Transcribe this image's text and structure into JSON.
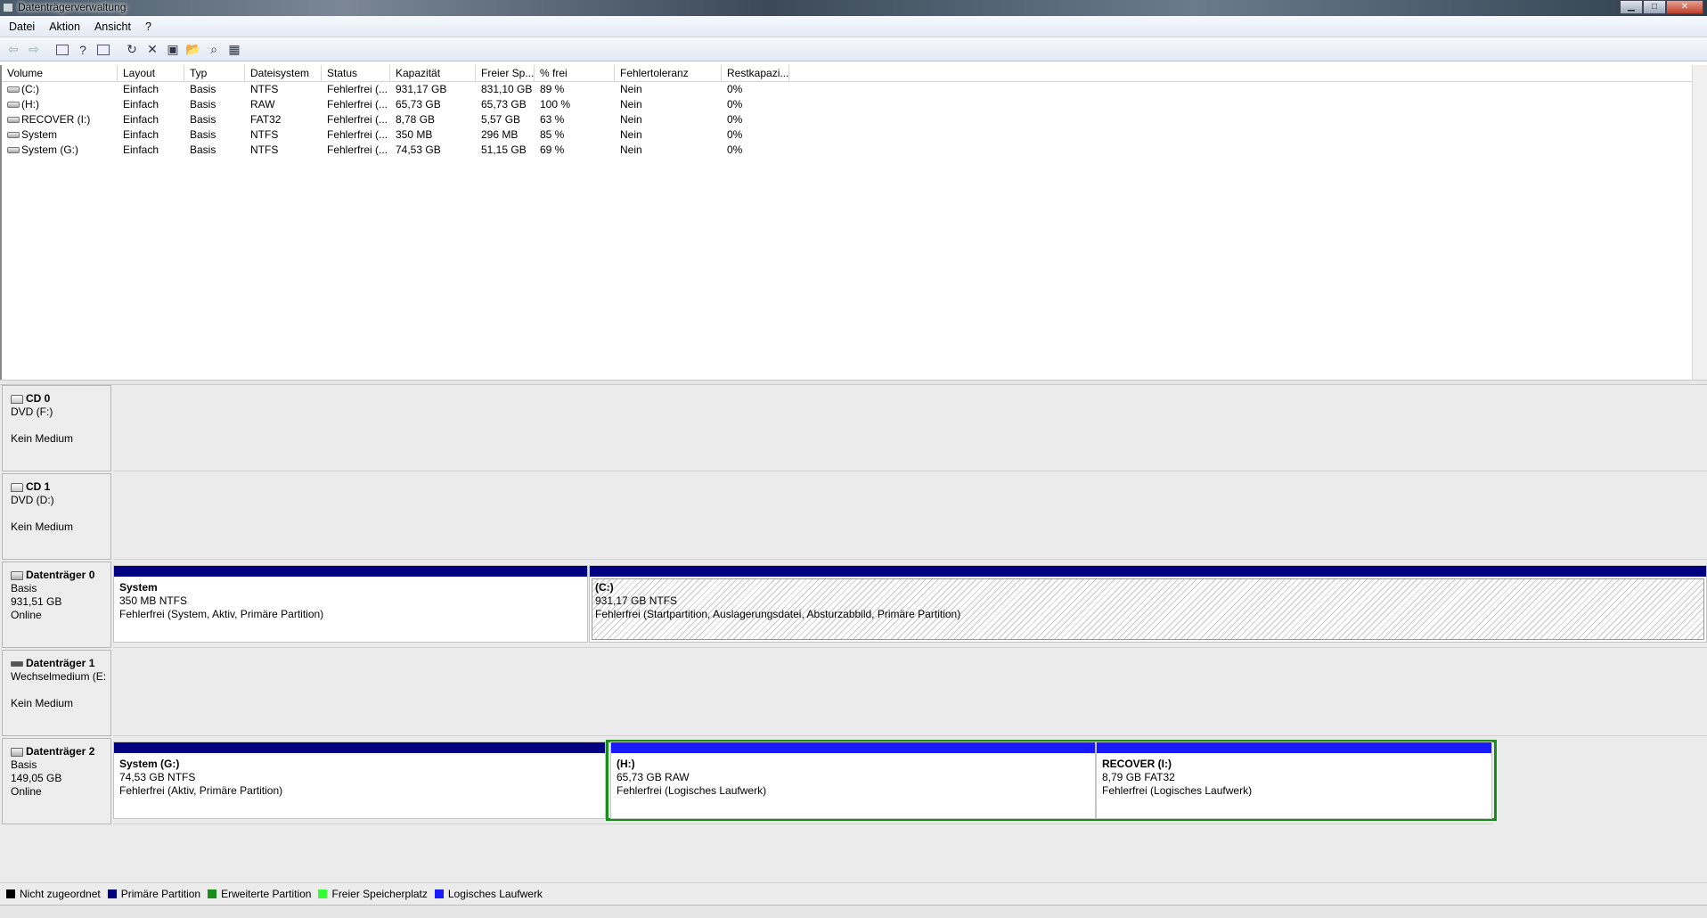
{
  "window": {
    "title": "Datenträgerverwaltung",
    "min_glyph": "▁",
    "max_glyph": "□",
    "close_glyph": "✕"
  },
  "menu": [
    "Datei",
    "Aktion",
    "Ansicht",
    "?"
  ],
  "toolbar": {
    "icons": [
      "back-arrow-icon",
      "forward-arrow-icon",
      "console-tree-icon",
      "help-icon",
      "show-hide-icon",
      "refresh-icon",
      "delete-icon",
      "properties-icon",
      "open-icon",
      "explore-icon",
      "settings-icon"
    ],
    "glyphs": {
      "back": "⇦",
      "forward": "⇨",
      "help": "?",
      "refresh": "↻",
      "delete": "✕",
      "properties": "▣",
      "open": "📂",
      "explore": "⌕",
      "settings": "▦"
    }
  },
  "volumes": {
    "columns": [
      "Volume",
      "Layout",
      "Typ",
      "Dateisystem",
      "Status",
      "Kapazität",
      "Freier Sp...",
      "% frei",
      "Fehlertoleranz",
      "Restkapazi..."
    ],
    "rows": [
      [
        "(C:)",
        "Einfach",
        "Basis",
        "NTFS",
        "Fehlerfrei (...",
        "931,17 GB",
        "831,10 GB",
        "89 %",
        "Nein",
        "0%"
      ],
      [
        "(H:)",
        "Einfach",
        "Basis",
        "RAW",
        "Fehlerfrei (...",
        "65,73 GB",
        "65,73 GB",
        "100 %",
        "Nein",
        "0%"
      ],
      [
        "RECOVER (I:)",
        "Einfach",
        "Basis",
        "FAT32",
        "Fehlerfrei (...",
        "8,78 GB",
        "5,57 GB",
        "63 %",
        "Nein",
        "0%"
      ],
      [
        "System",
        "Einfach",
        "Basis",
        "NTFS",
        "Fehlerfrei (...",
        "350 MB",
        "296 MB",
        "85 %",
        "Nein",
        "0%"
      ],
      [
        "System (G:)",
        "Einfach",
        "Basis",
        "NTFS",
        "Fehlerfrei (...",
        "74,53 GB",
        "51,15 GB",
        "69 %",
        "Nein",
        "0%"
      ]
    ]
  },
  "disks": {
    "cd0": {
      "name": "CD 0",
      "line1": "DVD (F:)",
      "line3": "Kein Medium"
    },
    "cd1": {
      "name": "CD 1",
      "line1": "DVD (D:)",
      "line3": "Kein Medium"
    },
    "disk0": {
      "name": "Datenträger 0",
      "type": "Basis",
      "size": "931,51 GB",
      "state": "Online",
      "p1": {
        "name": "System",
        "size": "350 MB NTFS",
        "status": "Fehlerfrei (System, Aktiv, Primäre Partition)"
      },
      "p2": {
        "name": "(C:)",
        "size": "931,17 GB NTFS",
        "status": "Fehlerfrei (Startpartition, Auslagerungsdatei, Absturzabbild, Primäre Partition)"
      }
    },
    "disk1": {
      "name": "Datenträger 1",
      "line1": "Wechselmedium (E:",
      "line3": "Kein Medium"
    },
    "disk2": {
      "name": "Datenträger 2",
      "type": "Basis",
      "size": "149,05 GB",
      "state": "Online",
      "p1": {
        "name": "System  (G:)",
        "size": "74,53 GB NTFS",
        "status": "Fehlerfrei (Aktiv, Primäre Partition)"
      },
      "p2": {
        "name": "(H:)",
        "size": "65,73 GB RAW",
        "status": "Fehlerfrei (Logisches Laufwerk)"
      },
      "p3": {
        "name": "RECOVER  (I:)",
        "size": "8,79 GB FAT32",
        "status": "Fehlerfrei (Logisches Laufwerk)"
      }
    }
  },
  "legend": [
    {
      "label": "Nicht zugeordnet",
      "color": "#000000"
    },
    {
      "label": "Primäre Partition",
      "color": "#000080"
    },
    {
      "label": "Erweiterte Partition",
      "color": "#1a8c1a"
    },
    {
      "label": "Freier Speicherplatz",
      "color": "#33ff33"
    },
    {
      "label": "Logisches Laufwerk",
      "color": "#1a1aff"
    }
  ]
}
